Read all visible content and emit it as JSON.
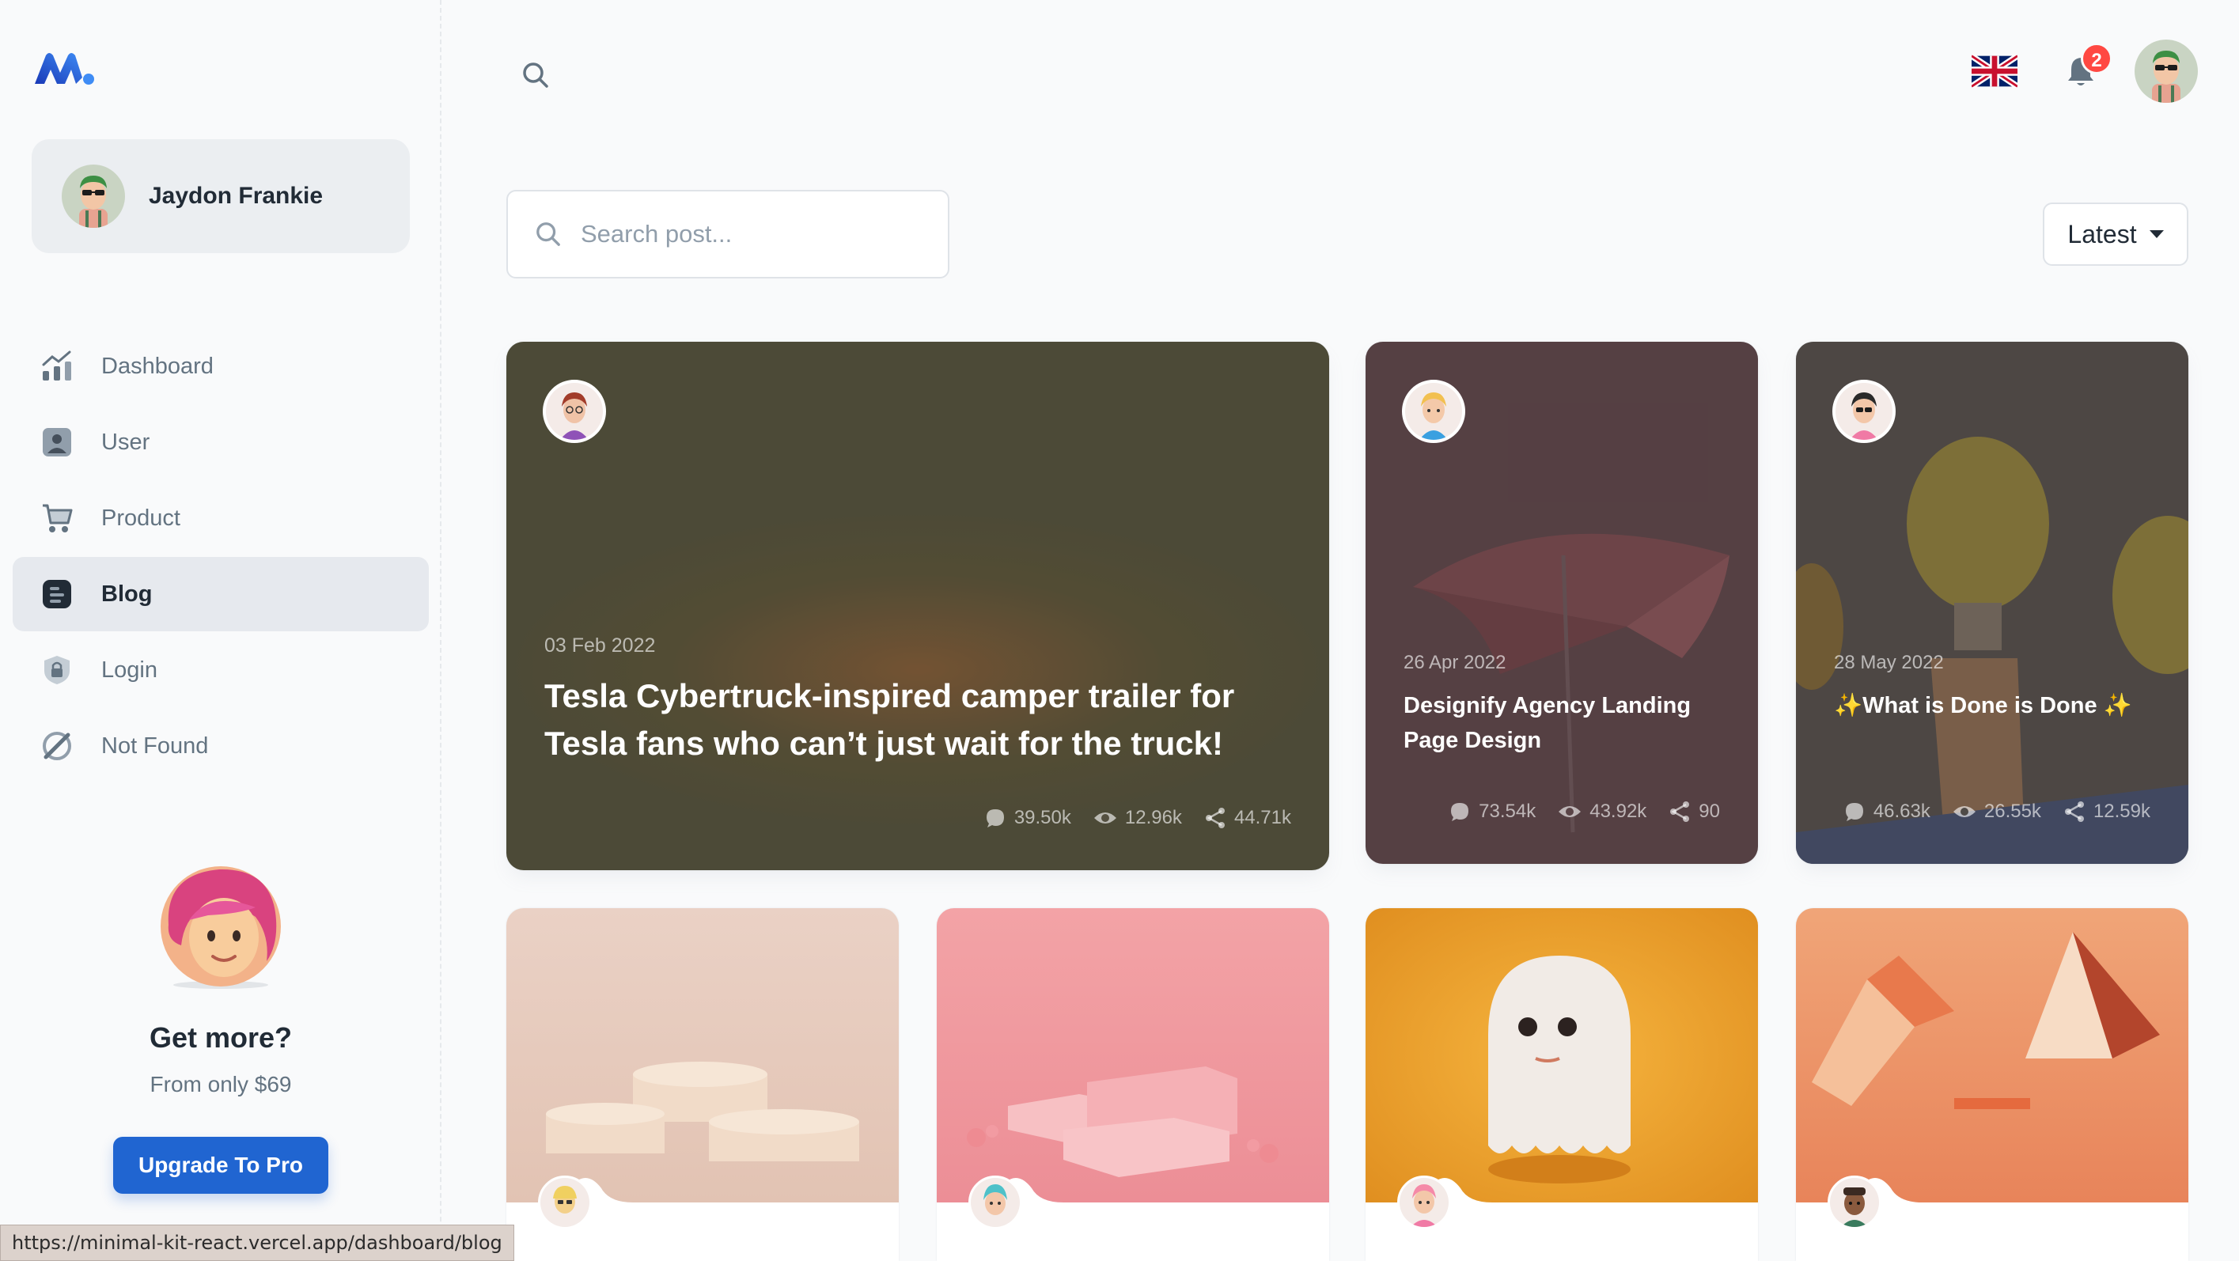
{
  "sidebar": {
    "account_name": "Jaydon Frankie",
    "nav": [
      {
        "label": "Dashboard",
        "icon": "chart-bar-icon"
      },
      {
        "label": "User",
        "icon": "user-icon"
      },
      {
        "label": "Product",
        "icon": "cart-icon"
      },
      {
        "label": "Blog",
        "icon": "blog-icon",
        "active": true
      },
      {
        "label": "Login",
        "icon": "lock-icon"
      },
      {
        "label": "Not Found",
        "icon": "slash-circle-icon"
      }
    ],
    "promo": {
      "title": "Get more?",
      "subtitle": "From only $69",
      "button": "Upgrade To Pro"
    }
  },
  "header": {
    "notification_count": "2"
  },
  "toolbar": {
    "search_placeholder": "Search post...",
    "sort_label": "Latest"
  },
  "posts": [
    {
      "date": "03 Feb 2022",
      "title": "Tesla Cybertruck-inspired camper trailer for Tesla fans who can’t just wait for the truck!",
      "comments": "39.50k",
      "views": "12.96k",
      "shares": "44.71k"
    },
    {
      "date": "26 Apr 2022",
      "title": "Designify Agency Landing Page Design",
      "comments": "73.54k",
      "views": "43.92k",
      "shares": "90"
    },
    {
      "date": "28 May 2022",
      "title": "✨What is Done is Done ✨",
      "comments": "46.63k",
      "views": "26.55k",
      "shares": "12.59k"
    }
  ],
  "status_url": "https://minimal-kit-react.vercel.app/dashboard/blog",
  "colors": {
    "primary": "#2065d1",
    "badge": "#ff4842",
    "active_nav_bg": "#e6e9ee"
  }
}
